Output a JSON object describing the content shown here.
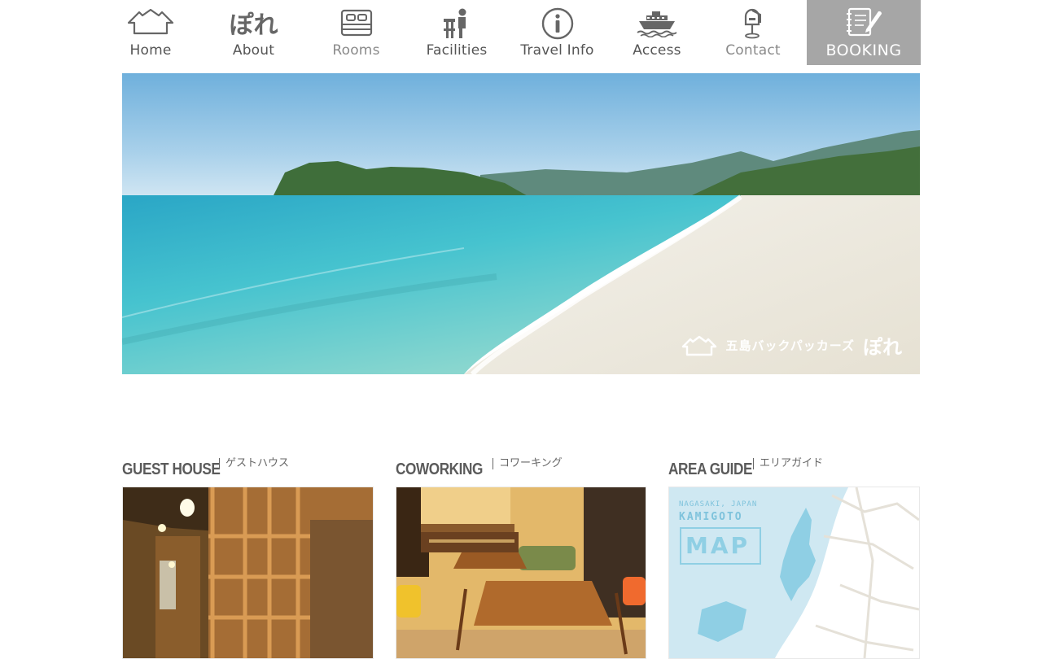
{
  "nav": {
    "items": [
      {
        "label": "Home",
        "icon": "house-icon"
      },
      {
        "label": "About",
        "icon": "pore-logo-icon"
      },
      {
        "label": "Rooms",
        "icon": "bed-icon"
      },
      {
        "label": "Facilities",
        "icon": "desk-person-icon"
      },
      {
        "label": "Travel Info",
        "icon": "info-icon"
      },
      {
        "label": "Access",
        "icon": "ship-icon"
      },
      {
        "label": "Contact",
        "icon": "mailbox-icon"
      },
      {
        "label": "BOOKING",
        "icon": "notebook-pen-icon"
      }
    ],
    "about_logo_text": "ぽれ",
    "booking_bg": "#a6a6a6"
  },
  "hero": {
    "logo_text": "五島バックパッカーズ",
    "logo_brand": "ぽれ"
  },
  "sections": [
    {
      "title": "GUEST HOUSE",
      "subtitle": "ゲストハウス"
    },
    {
      "title": "COWORKING",
      "subtitle": "コワーキング"
    },
    {
      "title": "AREA GUIDE",
      "subtitle": "エリアガイド"
    }
  ],
  "map": {
    "line1": "NAGASAKI, JAPAN",
    "line2": "KAMIGOTO",
    "line3": "MAP"
  }
}
